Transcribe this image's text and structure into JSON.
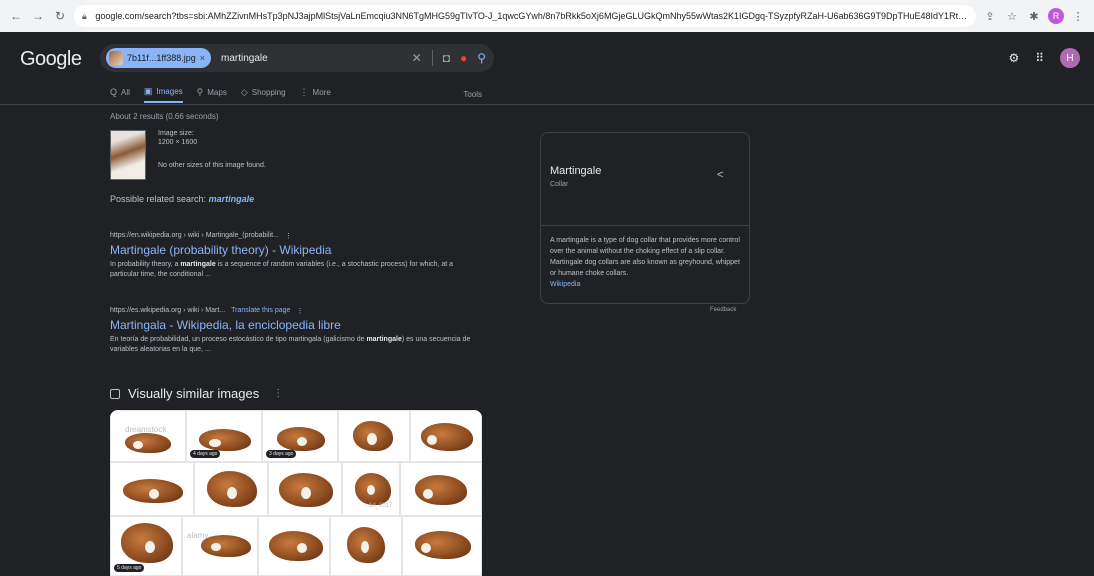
{
  "browser": {
    "url": "google.com/search?tbs=sbi:AMhZZivnMHsTp3pNJ3ajpMlStsjVaLnEmcqiu3NN6TgMHG59gTIvTO-J_1qwcGYwh/8n7bRkk5oXj6MGjeGLUGkQmNhy55wWtas2K1IGDgq-TSyzpfyRZaH-U6ab636G9T9DpTHuE48IdY1Rt T3ICRSLIM-Z--EQzhGLLE7W0opDKju9DPLQyki-v..."
  },
  "header": {
    "logo": "Google",
    "chip_label": "7b11f...1ff388.jpg",
    "chip_close": "×",
    "query": "martingale",
    "avatar_letter": "H",
    "profile_letter": "R"
  },
  "tabs": [
    {
      "label": "All",
      "icon": "search-icon",
      "glyph": "Q"
    },
    {
      "label": "Images",
      "icon": "image-icon",
      "glyph": "▣"
    },
    {
      "label": "Maps",
      "icon": "map-pin-icon",
      "glyph": "⚲"
    },
    {
      "label": "Shopping",
      "icon": "tag-icon",
      "glyph": "◇"
    },
    {
      "label": "More",
      "icon": "more-vertical-icon",
      "glyph": "⋮"
    }
  ],
  "tools_label": "Tools",
  "results_count": "About 2 results (0.66 seconds)",
  "image_info": {
    "size_label": "Image size:",
    "size_value": "1200 × 1600",
    "no_other": "No other sizes of this image found."
  },
  "related": {
    "prefix": "Possible related search:",
    "term": "martingale"
  },
  "results": [
    {
      "url": "https://en.wikipedia.org › wiki › Martingale_(probabilit...",
      "translate": "",
      "title": "Martingale (probability theory) - Wikipedia",
      "snippet_pre": "In probability theory, a ",
      "snippet_bold": "martingale",
      "snippet_post": " is a sequence of random variables (i.e., a stochastic process) for which, at a particular time, the conditional ..."
    },
    {
      "url": "https://es.wikipedia.org › wiki › Mart...",
      "translate": "Translate this page",
      "title": "Martingala - Wikipedia, la enciclopedia libre",
      "snippet_pre": "En teoría de probabilidad, un proceso estocástico de tipo martingala (galicismo de ",
      "snippet_bold": "martingale",
      "snippet_post": ") es una secuencia de variables aleatorias en la que, ..."
    }
  ],
  "similar": {
    "title": "Visually similar images",
    "badges": [
      "4 days ago",
      "3 days ago",
      "5 days ago"
    ],
    "watermark": "alamy"
  },
  "knowledge_panel": {
    "title": "Martingale",
    "subtitle": "Collar",
    "description": "A martingale is a type of dog collar that provides more control over the animal without the choking effect of a slip collar. Martingale dog collars are also known as greyhound, whippet or humane choke collars.",
    "source": "Wikipedia",
    "feedback": "Feedback"
  }
}
